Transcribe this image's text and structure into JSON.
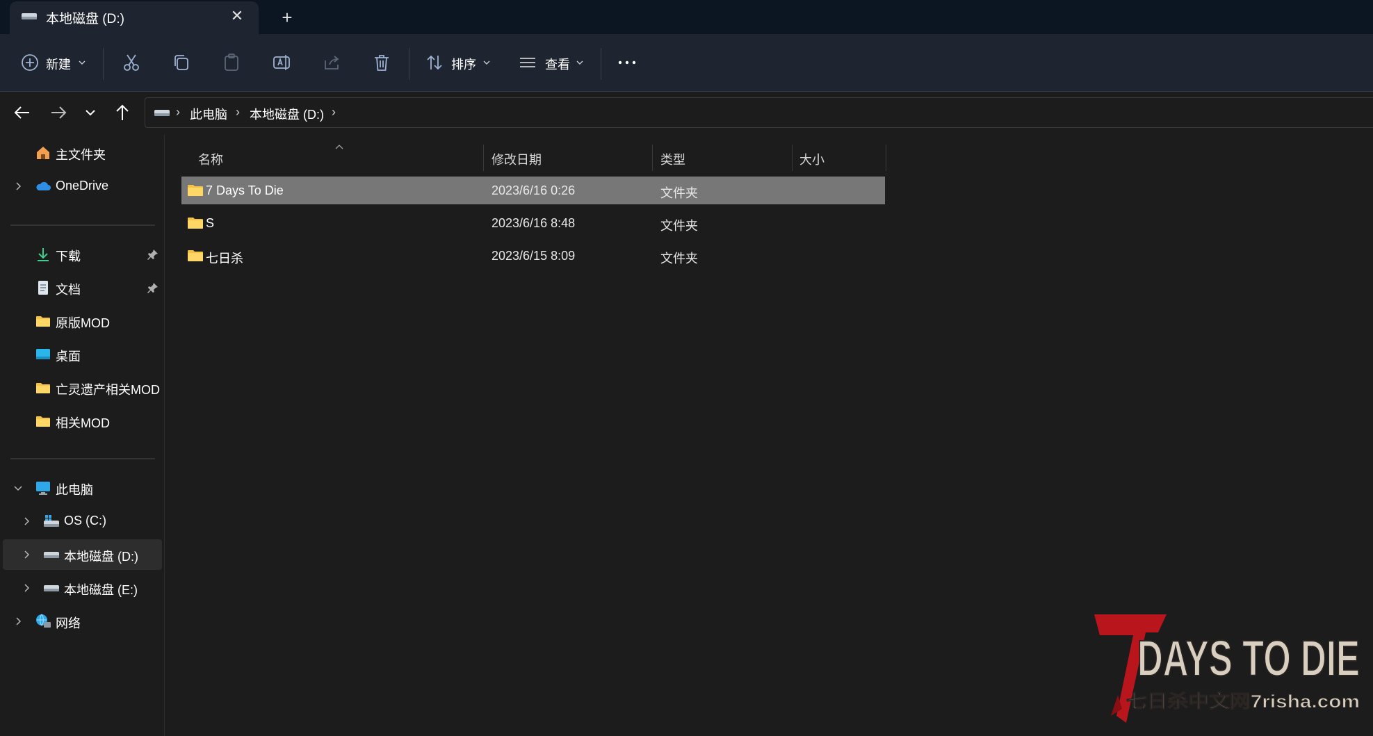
{
  "tab": {
    "title": "本地磁盘 (D:)"
  },
  "toolbar": {
    "new_label": "新建",
    "sort_label": "排序",
    "view_label": "查看"
  },
  "breadcrumb": [
    "此电脑",
    "本地磁盘 (D:)"
  ],
  "sidebar": {
    "quick": [
      {
        "label": "主文件夹",
        "icon": "home-icon"
      },
      {
        "label": "OneDrive",
        "icon": "cloud-icon"
      }
    ],
    "pinned": [
      {
        "label": "下载",
        "icon": "download-icon",
        "pinned": true
      },
      {
        "label": "文档",
        "icon": "document-icon",
        "pinned": true
      },
      {
        "label": "原版MOD",
        "icon": "folder-icon"
      },
      {
        "label": "桌面",
        "icon": "desktop-icon"
      },
      {
        "label": "亡灵遗产相关MOD",
        "icon": "folder-icon"
      },
      {
        "label": "相关MOD",
        "icon": "folder-icon"
      }
    ],
    "this_pc": {
      "label": "此电脑",
      "icon": "computer-icon"
    },
    "drives": [
      {
        "label": "OS (C:)",
        "icon": "os-drive-icon"
      },
      {
        "label": "本地磁盘 (D:)",
        "icon": "drive-icon",
        "selected": true
      },
      {
        "label": "本地磁盘 (E:)",
        "icon": "drive-icon"
      }
    ],
    "network": {
      "label": "网络",
      "icon": "network-icon"
    }
  },
  "columns": {
    "name": "名称",
    "date": "修改日期",
    "type": "类型",
    "size": "大小"
  },
  "files": [
    {
      "name": "7 Days To Die",
      "date": "2023/6/16 0:26",
      "type": "文件夹",
      "selected": true
    },
    {
      "name": "S",
      "date": "2023/6/16 8:48",
      "type": "文件夹"
    },
    {
      "name": "七日杀",
      "date": "2023/6/15 8:09",
      "type": "文件夹"
    }
  ],
  "watermark": {
    "line1": "DAYS TO DIE",
    "line2": "七日杀中文网7risha.com"
  },
  "colors": {
    "accent": "#9fb3d4",
    "folder": "#f5c342",
    "selected_row": "#777777",
    "logo_red": "#b8161c"
  }
}
